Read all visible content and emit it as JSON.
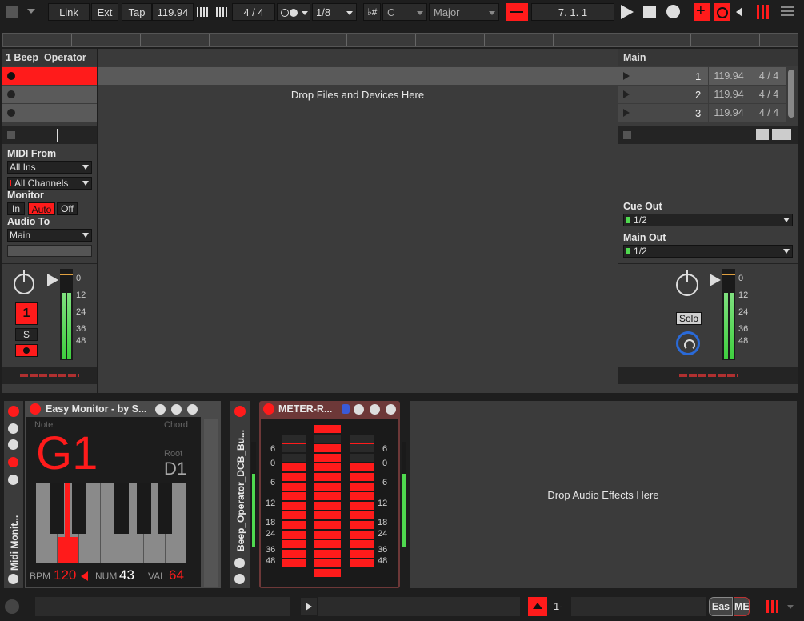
{
  "transport": {
    "link": "Link",
    "ext": "Ext",
    "tap": "Tap",
    "tempo": "119.94",
    "signature": "4 / 4",
    "quantize": "1/8",
    "key": "C",
    "scale": "Major",
    "position": "7.  1.  1"
  },
  "track": {
    "name": "1 Beep_Operator",
    "midi_from_label": "MIDI From",
    "midi_from_value": "All Ins",
    "channels_value": "All Channels",
    "monitor_label": "Monitor",
    "monitor_in": "In",
    "monitor_auto": "Auto",
    "monitor_off": "Off",
    "audio_to_label": "Audio To",
    "audio_to_value": "Main",
    "track_number": "1",
    "solo": "S",
    "meter_scale": [
      "0",
      "12",
      "24",
      "36",
      "48"
    ]
  },
  "arrangement": {
    "drop_text": "Drop Files and Devices Here"
  },
  "main": {
    "name": "Main",
    "scenes": [
      {
        "num": "1",
        "tempo": "119.94",
        "sig": "4 / 4"
      },
      {
        "num": "2",
        "tempo": "119.94",
        "sig": "4 / 4"
      },
      {
        "num": "3",
        "tempo": "119.94",
        "sig": "4 / 4"
      }
    ],
    "cue_out_label": "Cue Out",
    "cue_out_value": "1/2",
    "main_out_label": "Main Out",
    "main_out_value": "1/2",
    "solo": "Solo",
    "meter_scale": [
      "0",
      "12",
      "24",
      "36",
      "48"
    ]
  },
  "devices": {
    "rack_label": "Midi Monit...",
    "easy_monitor": {
      "title": "Easy Monitor - by S...",
      "note_label": "Note",
      "note_value": "G1",
      "chord_label": "Chord",
      "root_label": "Root",
      "root_value": "D1",
      "bpm_label": "BPM",
      "bpm_value": "120",
      "num_label": "NUM",
      "num_value": "43",
      "val_label": "VAL",
      "val_value": "64"
    },
    "rack2_label": "Beep_Operator_DCB_Bu...",
    "meter": {
      "title": "METER-R...",
      "scale": [
        "6",
        "0",
        "6",
        "12",
        "18",
        "24",
        "36",
        "48"
      ]
    },
    "drop_effects": "Drop Audio Effects Here"
  },
  "status": {
    "clip_label": "1-",
    "easy_tab": "Eas",
    "me_tab": "ME"
  },
  "colors": {
    "accent_red": "#ff1b1b",
    "meter_green": "#4fd94f"
  }
}
